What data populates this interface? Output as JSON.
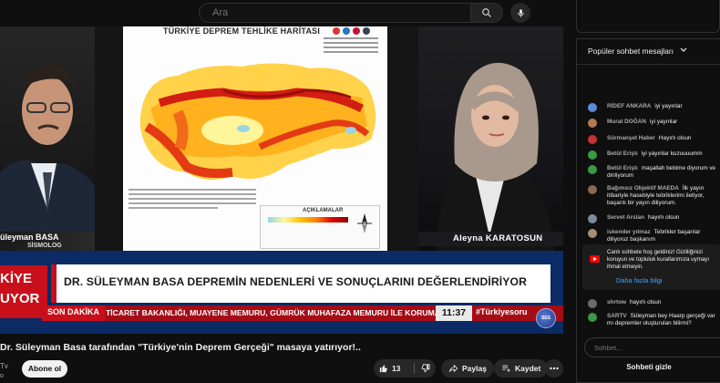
{
  "search": {
    "placeholder": "Ara"
  },
  "video": {
    "map_title": "TÜRKİYE DEPREM TEHLİKE HARİTASI",
    "legend_title": "AÇIKLAMALAR",
    "speaker_left_name": "üleyman BASA",
    "speaker_left_title": "SİSMOLOG",
    "speaker_right_name": "Aleyna KARATOSUN",
    "brand_line1": "KİYE",
    "brand_line2": "UYOR",
    "headline": "DR. SÜLEYMAN BASA DEPREMİN NEDENLERİ VE SONUÇLARINI DEĞERLENDİRİYOR",
    "ticker_tag": "SON DAKİKA",
    "ticker_text": "TİCARET BAKANLIĞI, MUAYENE MEMURU, GÜMRÜK MUHAFAZA MEMURU İLE KORUMA VE",
    "clock": "11:37",
    "hashtag": "#Türkiyesoru",
    "channel_bug": "SES"
  },
  "below": {
    "title": "Dr. Süleyman Basa tarafından \"Türkiye'nin Deprem Gerçeği\" masaya yatırıyor!..",
    "channel_line1": "Tv",
    "channel_line2": "o",
    "subscribe_label": "Abone ol",
    "like_count": "13",
    "share_label": "Paylaş",
    "save_label": "Kaydet"
  },
  "chat": {
    "header": "Popüler sohbet mesajları",
    "messages": [
      {
        "author": "RİDEF ANKARA",
        "text": "iyi yayınlar",
        "color": "#5b8ad8"
      },
      {
        "author": "Murat DOĞAN",
        "text": "iyi yayınlar",
        "color": "#b07a55"
      },
      {
        "author": "Sürmanşet Haber",
        "text": "Hayırlı olsun",
        "color": "#c43333"
      },
      {
        "author": "Betül Eriştı",
        "text": "iyi yayınlar kuzuuuumm",
        "color": "#3a9a44"
      },
      {
        "author": "Betül Eriştı",
        "text": "maşallah bebime diyorum ve dinliyorum",
        "color": "#3a9a44"
      },
      {
        "author": "Bağımsız Objektif MAEDA",
        "text": "İlk yayın itibariyle hasebiyle tebriklerimi iletiyor, başarılı bir yayın diliyorum.",
        "color": "#8a6a50"
      },
      {
        "author": "Servet Arslan",
        "text": "hayırlı olsun",
        "color": "#7d8a99"
      },
      {
        "author": "iskender yılmaz",
        "text": "Tebrikler başarılar diliyoruz başkanım",
        "color": "#a58e74"
      },
      {
        "author": "shrtow",
        "text": "hayırlı olsun",
        "color": "#6b6b6b"
      },
      {
        "author": "SARTV",
        "text": "Süleyman bey Haarp gerçeği var mı depremler oluşturulan bilirmi?",
        "color": "#3a9a44"
      }
    ],
    "notice_text": "Canlı sohbete hoş geldiniz! Gizliliğinizi koruyun ve topluluk kurallarımıza uymayı ihmal etmeyin.",
    "notice_link": "Daha fazla bilgi",
    "input_placeholder": "Sohbet...",
    "hide_label": "Sohbeti gizle"
  }
}
